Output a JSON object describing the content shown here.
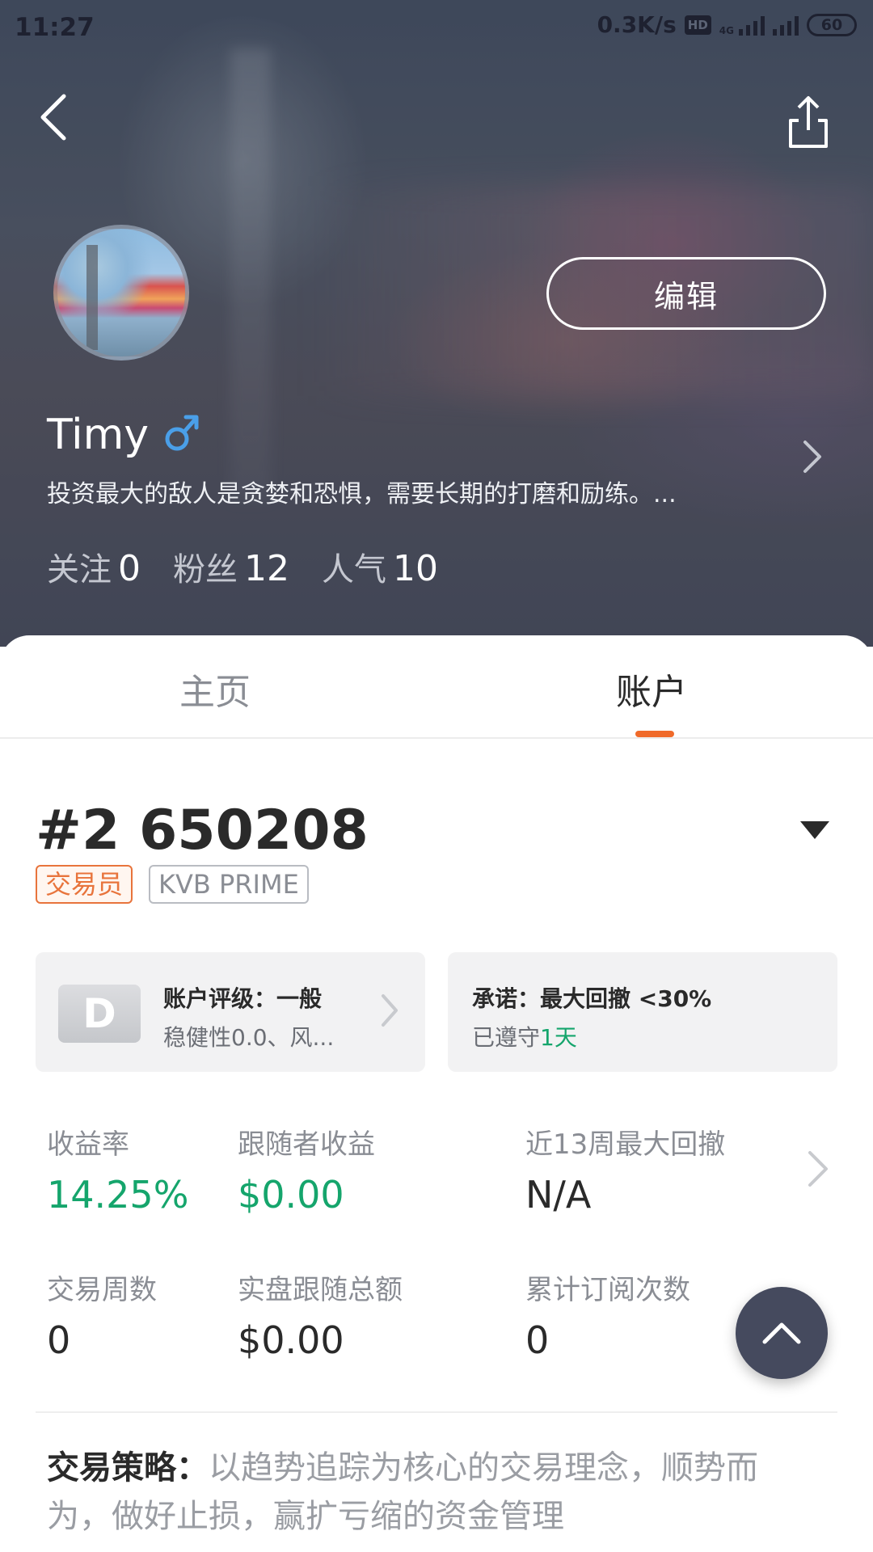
{
  "status_bar": {
    "time": "11:27",
    "speed": "0.3K/s",
    "hd": "HD",
    "network": "4G",
    "battery": "60"
  },
  "profile": {
    "name": "Timy",
    "gender_icon": "male-symbol-icon",
    "bio": "投资最大的敌人是贪婪和恐惧，需要长期的打磨和励练。...",
    "edit_label": "编辑",
    "stats": [
      {
        "label": "关注",
        "value": "0"
      },
      {
        "label": "粉丝",
        "value": "12"
      },
      {
        "label": "人气",
        "value": "10"
      }
    ]
  },
  "tabs": [
    {
      "label": "主页",
      "active": false
    },
    {
      "label": "账户",
      "active": true
    }
  ],
  "account": {
    "number": "#2 650208",
    "tags": [
      "交易员",
      "KVB PRIME"
    ],
    "rating": {
      "grade": "D",
      "title": "账户评级：一般",
      "sub": "稳健性0.0、风..."
    },
    "promise": {
      "title": "承诺：最大回撤 <30%",
      "sub_prefix": "已遵守",
      "days": "1天"
    }
  },
  "metrics": [
    {
      "label": "收益率",
      "value": "14.25%",
      "highlight": true
    },
    {
      "label": "跟随者收益",
      "value": "$0.00",
      "highlight": true
    },
    {
      "label": "近13周最大回撤",
      "value": "N/A",
      "highlight": false
    },
    {
      "label": "交易周数",
      "value": "0",
      "highlight": false
    },
    {
      "label": "实盘跟随总额",
      "value": "$0.00",
      "highlight": false
    },
    {
      "label": "累计订阅次数",
      "value": "0",
      "highlight": false
    }
  ],
  "strategy": {
    "label": "交易策略：",
    "text": "以趋势追踪为核心的交易理念，顺势而为，做好止损，赢扩亏缩的资金管理"
  },
  "colors": {
    "accent": "#f06a2a",
    "positive": "#15a56c",
    "fab": "#454a5e"
  }
}
